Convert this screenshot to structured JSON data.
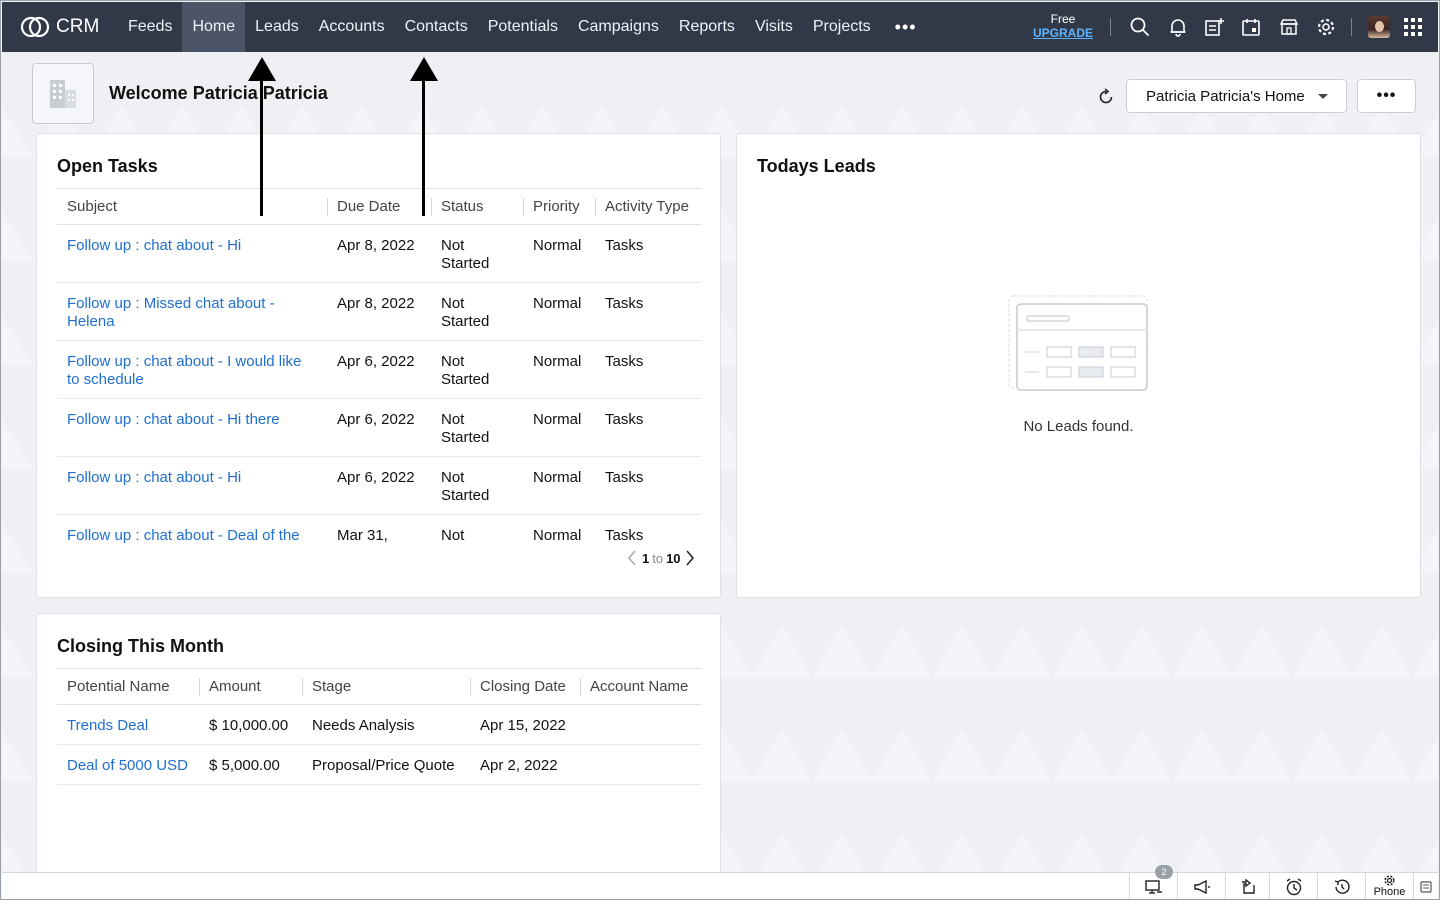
{
  "topbar": {
    "logo_text": "CRM",
    "nav_items": [
      "Feeds",
      "Home",
      "Leads",
      "Accounts",
      "Contacts",
      "Potentials",
      "Campaigns",
      "Reports",
      "Visits",
      "Projects"
    ],
    "active_item": "Home",
    "more_label": "•••",
    "free_label": "Free",
    "upgrade_label": "UPGRADE",
    "icons": [
      "search-icon",
      "bell-icon",
      "compose-icon",
      "calendar-icon",
      "marketplace-icon",
      "gear-icon",
      "avatar",
      "app-grid-icon"
    ]
  },
  "header": {
    "welcome": "Welcome Patricia Patricia",
    "home_select": "Patricia Patricia's Home",
    "more_label": "•••"
  },
  "open_tasks": {
    "title": "Open Tasks",
    "columns": [
      "Subject",
      "Due Date",
      "Status",
      "Priority",
      "Activity Type"
    ],
    "rows": [
      {
        "subject": "Follow up : chat about - Hi",
        "due": "Apr 8, 2022",
        "status": "Not Started",
        "priority": "Normal",
        "type": "Tasks"
      },
      {
        "subject": "Follow up : Missed chat about -Helena",
        "due": "Apr 8, 2022",
        "status": "Not Started",
        "priority": "Normal",
        "type": "Tasks"
      },
      {
        "subject": "Follow up : chat about - I would like to schedule",
        "due": "Apr 6, 2022",
        "status": "Not Started",
        "priority": "Normal",
        "type": "Tasks"
      },
      {
        "subject": "Follow up : chat about - Hi there",
        "due": "Apr 6, 2022",
        "status": "Not Started",
        "priority": "Normal",
        "type": "Tasks"
      },
      {
        "subject": "Follow up : chat about - Hi",
        "due": "Apr 6, 2022",
        "status": "Not Started",
        "priority": "Normal",
        "type": "Tasks"
      },
      {
        "subject": "Follow up : chat about - Deal of the",
        "due": "Mar 31,",
        "status": "Not",
        "priority": "Normal",
        "type": "Tasks"
      }
    ],
    "pager": {
      "from": "1",
      "to_word": "to",
      "to": "10"
    }
  },
  "todays_leads": {
    "title": "Todays Leads",
    "empty_text": "No Leads found."
  },
  "closing_month": {
    "title": "Closing This Month",
    "columns": [
      "Potential Name",
      "Amount",
      "Stage",
      "Closing Date",
      "Account Name"
    ],
    "rows": [
      {
        "name": "Trends Deal",
        "amount": "$ 10,000.00",
        "stage": "Needs Analysis",
        "closing": "Apr 15, 2022",
        "account": ""
      },
      {
        "name": "Deal of 5000 USD",
        "amount": "$ 5,000.00",
        "stage": "Proposal/Price Quote",
        "closing": "Apr 2, 2022",
        "account": ""
      }
    ]
  },
  "bottombar": {
    "badge_count": "2",
    "phone_label": "Phone",
    "icons": [
      "chat-icon",
      "announcement-icon",
      "moon-icon",
      "alarm-icon",
      "history-icon",
      "phone-gear-icon",
      "notes-icon"
    ]
  }
}
